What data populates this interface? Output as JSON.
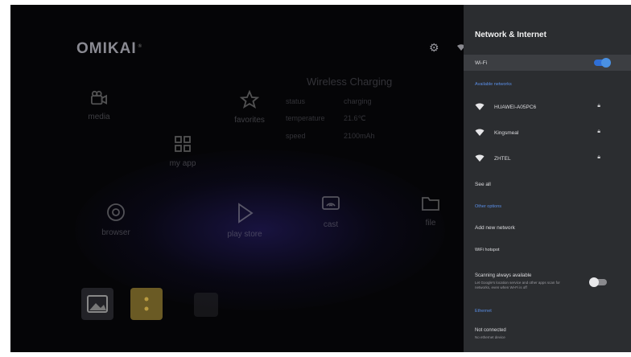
{
  "home": {
    "logo": "OMIKAI",
    "logo_mark": "®",
    "tiles": {
      "media": "media",
      "favorites": "favorites",
      "my_app": "my app",
      "chrome": "browser",
      "play_store": "play store",
      "cast": "cast",
      "file": "file"
    },
    "wireless": {
      "title": "Wireless Charging",
      "rows": [
        {
          "key": "status",
          "value": "charging"
        },
        {
          "key": "temperature",
          "value": "21.6℃"
        },
        {
          "key": "speed",
          "value": "2100mAh"
        }
      ]
    }
  },
  "panel": {
    "title": "Network & Internet",
    "wifi_label": "Wi-Fi",
    "wifi_on": true,
    "available_label": "Available networks",
    "networks": [
      {
        "name": "HUAWEI-A05PC6",
        "locked": true
      },
      {
        "name": "Kingsmeal",
        "locked": true
      },
      {
        "name": "ZHTEL",
        "locked": true
      }
    ],
    "see_all": "See all",
    "other_label": "Other options",
    "add_network": "Add new network",
    "hotspot": "WiFi hotspot",
    "scanning_label": "Scanning always available",
    "scanning_desc": "Let Google's location service and other apps scan for networks, even when Wi-Fi is off",
    "scanning_on": false,
    "ethernet_label": "Ethernet",
    "ethernet_status": "Not connected",
    "ethernet_sub": "No ethernet device"
  },
  "colors": {
    "accent": "#4a90e2",
    "panel": "#2b2d30",
    "dock_highlight": "#c9a23a"
  }
}
